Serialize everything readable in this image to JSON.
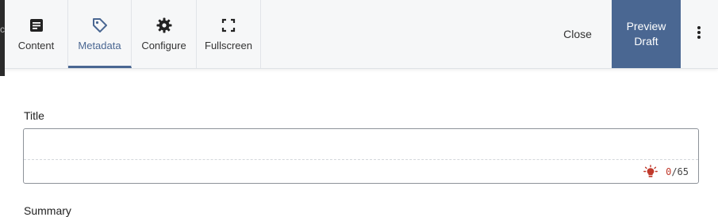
{
  "toolbar": {
    "tabs": [
      {
        "id": "content",
        "label": "Content",
        "icon": "document-icon"
      },
      {
        "id": "metadata",
        "label": "Metadata",
        "icon": "tag-icon",
        "active": true
      },
      {
        "id": "configure",
        "label": "Configure",
        "icon": "gear-icon"
      },
      {
        "id": "fullscreen",
        "label": "Fullscreen",
        "icon": "fullscreen-icon"
      }
    ],
    "close_label": "Close",
    "preview_label_line1": "Preview",
    "preview_label_line2": "Draft",
    "more_icon": "vertical-dots-icon"
  },
  "form": {
    "title_label": "Title",
    "title_value": "",
    "title_count": "0",
    "title_max": "/65",
    "hint_icon": "lightbulb-icon",
    "summary_label": "Summary"
  },
  "colors": {
    "accent": "#4a6792",
    "toolbar_bg": "#f6f7f8",
    "warning": "#c0392b"
  }
}
